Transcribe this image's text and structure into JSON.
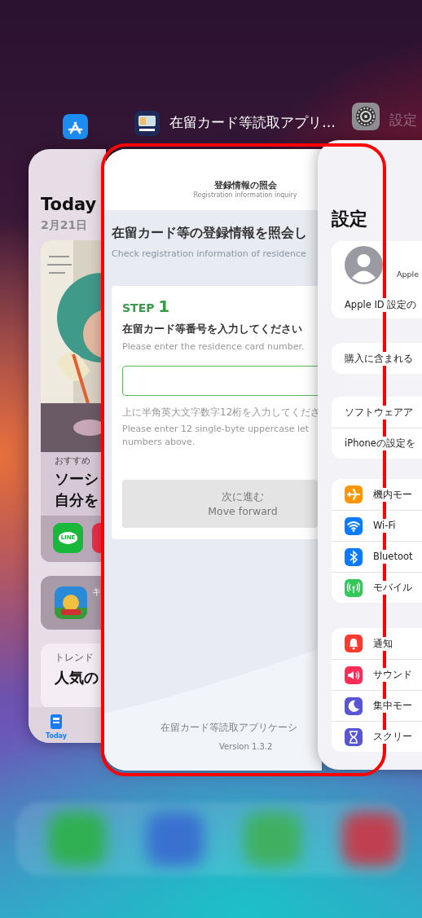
{
  "top_labels": {
    "center_title": "在留カード等読取アプリ…",
    "right_title": "設定"
  },
  "app_store_card": {
    "title": "Today",
    "date": "2月21日",
    "feature_eyebrow": "おすすめ",
    "feature_lines": [
      "ソーシ",
      "自分を"
    ],
    "chat_icon_text": "LINE",
    "app_row_text": "キ",
    "trend_eyebrow": "トレンド",
    "trend_headline": "人気の",
    "tab": {
      "label": "Today",
      "selected": true
    }
  },
  "residence_card": {
    "highlighted": true,
    "header_title": "登録情報の照会",
    "header_subtitle": "Registration information inquiry",
    "heading": "在留カード等の登録情報を照会し",
    "heading_en": "Check registration information of residence",
    "step_label": "STEP",
    "step_number": "1",
    "prompt": "在留カード等番号を入力してください",
    "prompt_en": "Please enter the residence card number.",
    "hint": "上に半角英大文字数字12桁を入力してくださ",
    "hint_en_lines": [
      "Please enter 12 single-byte uppercase let",
      "numbers above."
    ],
    "button": {
      "label": "次に進む",
      "label_en": "Move forward",
      "disabled": true
    },
    "footer_name": "在留カード等読取アプリケーシ",
    "version": "Version 1.3.2"
  },
  "settings_card": {
    "title": "設定",
    "profile_name": "Apple",
    "profile_row": "Apple ID 設定の",
    "groups": [
      {
        "rows": [
          {
            "label": "購入に含まれる"
          }
        ]
      },
      {
        "rows": [
          {
            "label": "ソフトウェアア"
          },
          {
            "label": "iPhoneの設定を"
          }
        ]
      },
      {
        "rows": [
          {
            "label": "機内モー",
            "kind": "airplane",
            "color": "#ff9500"
          },
          {
            "label": "Wi-Fi",
            "kind": "wifi",
            "color": "#0a7aff"
          },
          {
            "label": "Bluetoot",
            "kind": "bluetooth",
            "color": "#0a7aff"
          },
          {
            "label": "モバイル",
            "kind": "cellular",
            "color": "#34c759"
          }
        ]
      },
      {
        "rows": [
          {
            "label": "通知",
            "kind": "bell",
            "color": "#ff3b30"
          },
          {
            "label": "サウンド",
            "kind": "speaker",
            "color": "#ff2d55"
          },
          {
            "label": "集中モー",
            "kind": "moon",
            "color": "#5856d6"
          },
          {
            "label": "スクリー",
            "kind": "hourglass",
            "color": "#5856d6"
          }
        ]
      }
    ]
  }
}
